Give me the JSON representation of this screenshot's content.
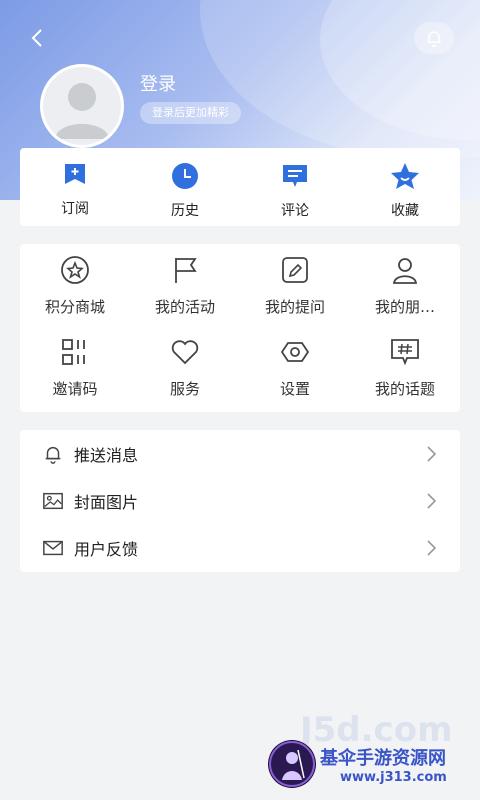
{
  "header": {
    "login_title": "登录",
    "login_hint": "登录后更加精彩"
  },
  "quick_actions": [
    {
      "label": "订阅",
      "icon": "subscribe-icon"
    },
    {
      "label": "历史",
      "icon": "history-clock-icon"
    },
    {
      "label": "评论",
      "icon": "comment-icon"
    },
    {
      "label": "收藏",
      "icon": "favorite-star-icon"
    }
  ],
  "grid_items": [
    {
      "label": "积分商城",
      "icon": "points-mall-icon"
    },
    {
      "label": "我的活动",
      "icon": "flag-icon"
    },
    {
      "label": "我的提问",
      "icon": "edit-question-icon"
    },
    {
      "label": "我的朋…",
      "icon": "friend-user-icon"
    },
    {
      "label": "邀请码",
      "icon": "invite-code-icon"
    },
    {
      "label": "服务",
      "icon": "heart-icon"
    },
    {
      "label": "设置",
      "icon": "settings-icon"
    },
    {
      "label": "我的话题",
      "icon": "topic-hash-icon"
    }
  ],
  "settings_list": [
    {
      "label": "推送消息",
      "icon": "bell-icon"
    },
    {
      "label": "封面图片",
      "icon": "image-icon"
    },
    {
      "label": "用户反馈",
      "icon": "feedback-mail-icon"
    }
  ],
  "watermark": {
    "brand": "基伞手游资源网",
    "url": "www.j313.com",
    "faint": "J5d.com"
  },
  "colors": {
    "accent": "#2f6fde",
    "header_gradient_start": "#7c9be6"
  }
}
